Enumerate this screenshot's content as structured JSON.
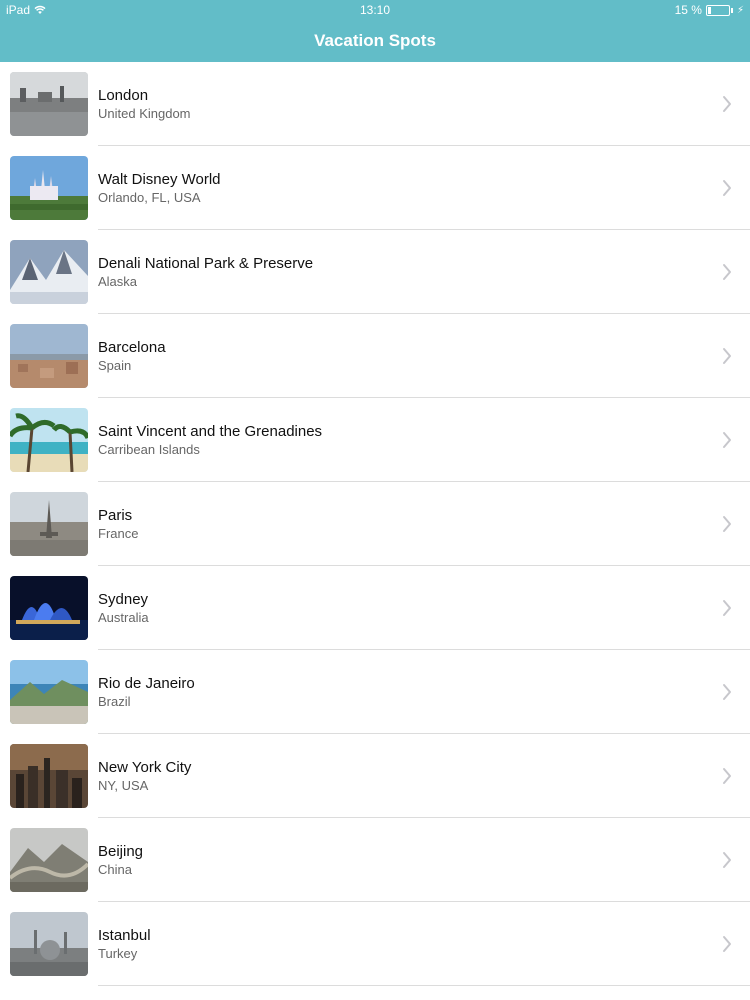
{
  "status_bar": {
    "carrier": "iPad",
    "time": "13:10",
    "battery_text": "15 %",
    "battery_level": 0.15
  },
  "nav": {
    "title": "Vacation Spots"
  },
  "list": {
    "items": [
      {
        "title": "London",
        "subtitle": "United Kingdom",
        "thumb": "london-thumbnail"
      },
      {
        "title": "Walt Disney World",
        "subtitle": "Orlando, FL, USA",
        "thumb": "disney-thumbnail"
      },
      {
        "title": "Denali National Park & Preserve",
        "subtitle": "Alaska",
        "thumb": "denali-thumbnail"
      },
      {
        "title": "Barcelona",
        "subtitle": "Spain",
        "thumb": "barcelona-thumbnail"
      },
      {
        "title": "Saint Vincent and the Grenadines",
        "subtitle": "Carribean Islands",
        "thumb": "st-vincent-thumbnail"
      },
      {
        "title": "Paris",
        "subtitle": "France",
        "thumb": "paris-thumbnail"
      },
      {
        "title": "Sydney",
        "subtitle": "Australia",
        "thumb": "sydney-thumbnail"
      },
      {
        "title": "Rio de Janeiro",
        "subtitle": "Brazil",
        "thumb": "rio-thumbnail"
      },
      {
        "title": "New York City",
        "subtitle": "NY, USA",
        "thumb": "nyc-thumbnail"
      },
      {
        "title": "Beijing",
        "subtitle": "China",
        "thumb": "beijing-thumbnail"
      },
      {
        "title": "Istanbul",
        "subtitle": "Turkey",
        "thumb": "istanbul-thumbnail"
      }
    ]
  },
  "colors": {
    "nav_bar": "#62bdc8",
    "separator": "#dcdcdc",
    "chevron": "#c7c7cc"
  }
}
